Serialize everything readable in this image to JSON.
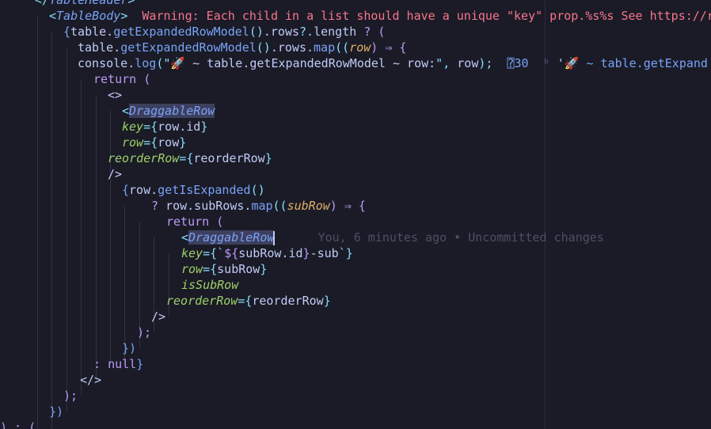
{
  "colors": {
    "background": "#1a1b26",
    "default": "#c0caf5",
    "tag": "#7aa2f7",
    "component": "#7aa2f7",
    "attr": "#9ece6a",
    "keyword": "#bb9af7",
    "function": "#7aa2f7",
    "punct": "#89ddff",
    "param": "#e0af68",
    "string": "#c0caf5",
    "error": "#f7768e",
    "blame": "#4b5066"
  },
  "editor": {
    "lines": [
      [
        {
          "t": "</",
          "c": "#89ddff"
        },
        {
          "t": "TableHeader",
          "c": "#7aa2f7",
          "i": true
        },
        {
          "t": ">",
          "c": "#89ddff"
        }
      ],
      [
        {
          "t": "<",
          "c": "#89ddff"
        },
        {
          "t": "TableBody",
          "c": "#7aa2f7",
          "i": true
        },
        {
          "t": ">",
          "c": "#89ddff"
        },
        {
          "t": "  Warning: Each child in a list should have a unique \"key\" prop.%s%s See https://r",
          "c": "#f7768e"
        }
      ],
      [
        {
          "t": "{",
          "c": "#7aa2f7"
        },
        {
          "t": "table.",
          "c": "#c0caf5"
        },
        {
          "t": "getExpandedRowModel",
          "c": "#7aa2f7"
        },
        {
          "t": "()",
          "c": "#89ddff"
        },
        {
          "t": ".rows",
          "c": "#c0caf5"
        },
        {
          "t": "?.",
          "c": "#89ddff"
        },
        {
          "t": "length ",
          "c": "#c0caf5"
        },
        {
          "t": "? (",
          "c": "#bb9af7"
        }
      ],
      [
        {
          "t": "table.",
          "c": "#c0caf5"
        },
        {
          "t": "getExpandedRowModel",
          "c": "#7aa2f7"
        },
        {
          "t": "()",
          "c": "#89ddff"
        },
        {
          "t": ".rows.",
          "c": "#c0caf5"
        },
        {
          "t": "map",
          "c": "#7aa2f7"
        },
        {
          "t": "((",
          "c": "#89ddff"
        },
        {
          "t": "row",
          "c": "#e0af68",
          "i": true
        },
        {
          "t": ") ⇒ {",
          "c": "#bb9af7"
        }
      ],
      [
        {
          "t": "console.",
          "c": "#c0caf5"
        },
        {
          "t": "log",
          "c": "#7aa2f7"
        },
        {
          "t": "(\"",
          "c": "#89ddff"
        },
        {
          "t": "🚀 ~ table.getExpandedRowModel ~ row:",
          "c": "#c0caf5"
        },
        {
          "t": "\", ",
          "c": "#89ddff"
        },
        {
          "t": "row",
          "c": "#c0caf5"
        },
        {
          "t": ");",
          "c": "#89ddff"
        },
        {
          "t": "  ⍰30  ",
          "c": "#7aa2f7"
        },
        {
          "t": "ᵇ",
          "c": "#565f89"
        },
        {
          "t": " '",
          "c": "#c0caf5"
        },
        {
          "t": "🚀 ~ table.getExpand",
          "c": "#7aa2f7"
        }
      ],
      [
        {
          "t": "return (",
          "c": "#bb9af7"
        }
      ],
      [
        {
          "t": "<>",
          "c": "#c0caf5"
        }
      ],
      [
        {
          "t": "<",
          "c": "#89ddff"
        },
        {
          "t": "DraggableRow",
          "c": "#7aa2f7",
          "i": true,
          "sel": true
        }
      ],
      [
        {
          "t": "key",
          "c": "#9ece6a",
          "i": true
        },
        {
          "t": "={",
          "c": "#89ddff"
        },
        {
          "t": "row.id",
          "c": "#c0caf5"
        },
        {
          "t": "}",
          "c": "#89ddff"
        }
      ],
      [
        {
          "t": "row",
          "c": "#9ece6a",
          "i": true
        },
        {
          "t": "={",
          "c": "#89ddff"
        },
        {
          "t": "row",
          "c": "#c0caf5"
        },
        {
          "t": "}",
          "c": "#89ddff"
        }
      ],
      [
        {
          "t": "reorderRow",
          "c": "#9ece6a",
          "i": true
        },
        {
          "t": "={",
          "c": "#89ddff"
        },
        {
          "t": "reorderRow",
          "c": "#c0caf5"
        },
        {
          "t": "}",
          "c": "#89ddff"
        }
      ],
      [
        {
          "t": "/>",
          "c": "#c0caf5"
        }
      ],
      [
        {
          "t": "{",
          "c": "#7aa2f7"
        },
        {
          "t": "row.",
          "c": "#c0caf5"
        },
        {
          "t": "getIsExpanded",
          "c": "#7aa2f7"
        },
        {
          "t": "()",
          "c": "#89ddff"
        }
      ],
      [
        {
          "t": "? ",
          "c": "#bb9af7"
        },
        {
          "t": "row.subRows.",
          "c": "#c0caf5"
        },
        {
          "t": "map",
          "c": "#7aa2f7"
        },
        {
          "t": "((",
          "c": "#89ddff"
        },
        {
          "t": "subRow",
          "c": "#e0af68",
          "i": true
        },
        {
          "t": ") ⇒ {",
          "c": "#bb9af7"
        }
      ],
      [
        {
          "t": "return (",
          "c": "#bb9af7"
        }
      ],
      [
        {
          "t": "<",
          "c": "#89ddff"
        },
        {
          "t": "DraggableRow",
          "c": "#7aa2f7",
          "i": true,
          "sel": true
        },
        {
          "cursor": true
        },
        {
          "t": "      You, 6 minutes ago • Uncommitted changes",
          "c": "#4b5066",
          "blame": true
        }
      ],
      [
        {
          "t": "key",
          "c": "#9ece6a",
          "i": true
        },
        {
          "t": "={`",
          "c": "#89ddff"
        },
        {
          "t": "${",
          "c": "#bb9af7"
        },
        {
          "t": "subRow.id",
          "c": "#c0caf5"
        },
        {
          "t": "}",
          "c": "#bb9af7"
        },
        {
          "t": "-sub",
          "c": "#c0caf5"
        },
        {
          "t": "`}",
          "c": "#89ddff"
        }
      ],
      [
        {
          "t": "row",
          "c": "#9ece6a",
          "i": true
        },
        {
          "t": "={",
          "c": "#89ddff"
        },
        {
          "t": "subRow",
          "c": "#c0caf5"
        },
        {
          "t": "}",
          "c": "#89ddff"
        }
      ],
      [
        {
          "t": "isSubRow",
          "c": "#9ece6a",
          "i": true
        }
      ],
      [
        {
          "t": "reorderRow",
          "c": "#9ece6a",
          "i": true
        },
        {
          "t": "={",
          "c": "#89ddff"
        },
        {
          "t": "reorderRow",
          "c": "#c0caf5"
        },
        {
          "t": "}",
          "c": "#89ddff"
        }
      ],
      [
        {
          "t": "/>",
          "c": "#c0caf5"
        }
      ],
      [
        {
          "t": ");",
          "c": "#bb9af7"
        }
      ],
      [
        {
          "t": "})",
          "c": "#7aa2f7"
        }
      ],
      [
        {
          "t": ": ",
          "c": "#bb9af7"
        },
        {
          "t": "null",
          "c": "#bb9af7"
        },
        {
          "t": "}",
          "c": "#7aa2f7"
        }
      ],
      [
        {
          "t": "</>",
          "c": "#c0caf5"
        }
      ],
      [
        {
          "t": ");",
          "c": "#bb9af7"
        }
      ],
      [
        {
          "t": "})",
          "c": "#7aa2f7"
        }
      ],
      [
        {
          "t": ") : (",
          "c": "#bb9af7"
        }
      ]
    ]
  }
}
